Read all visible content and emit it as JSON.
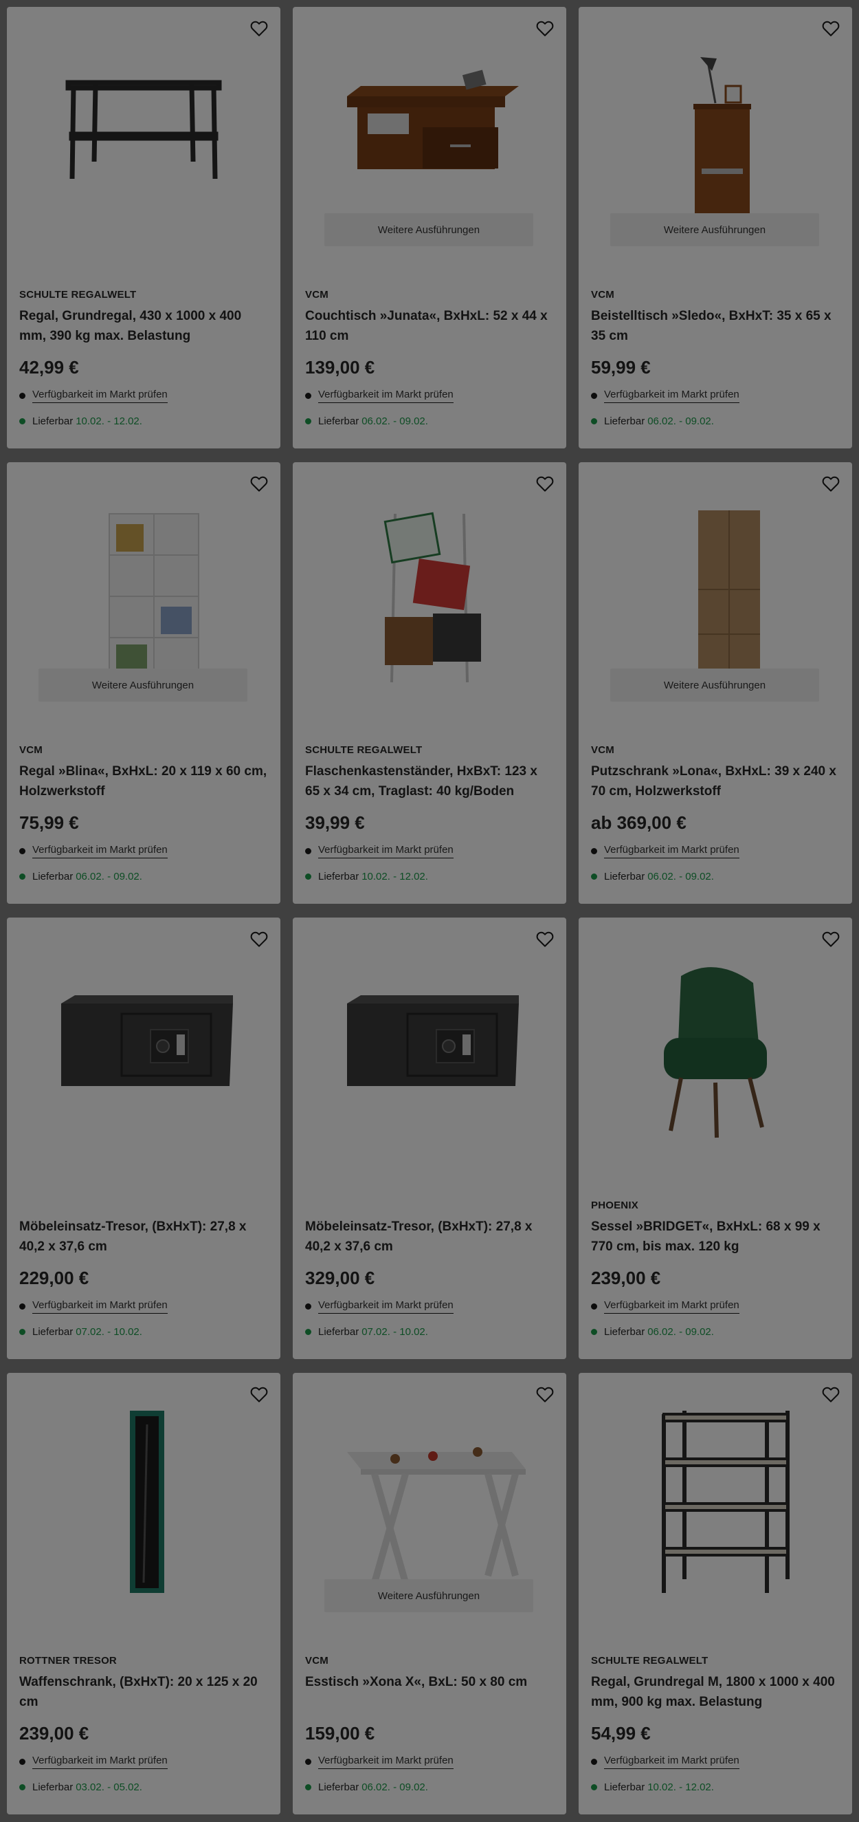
{
  "accent_color": "#1c9a4a",
  "overlay_color": "rgba(0,0,0,0.5)",
  "products": [
    {
      "image": "metal-shelf-wide",
      "brand": "SCHULTE REGALWELT",
      "title": "Regal, Grundregal, 430 x 1000 x 400 mm, 390 kg max. Belastung",
      "price": "42,99 €",
      "variants": "",
      "availability": "Verfügbarkeit im Markt prüfen",
      "delivery_label": "Lieferbar",
      "delivery_range": "10.02. - 12.02."
    },
    {
      "image": "coffee-table",
      "brand": "VCM",
      "title": "Couchtisch »Junata«, BxHxL: 52 x 44 x 110 cm",
      "price": "139,00 €",
      "variants": "Weitere Ausführungen",
      "availability": "Verfügbarkeit im Markt prüfen",
      "delivery_label": "Lieferbar",
      "delivery_range": "06.02. - 09.02."
    },
    {
      "image": "side-table",
      "brand": "VCM",
      "title": "Beistelltisch »Sledo«, BxHxT: 35 x 65 x 35 cm",
      "price": "59,99 €",
      "variants": "Weitere Ausführungen",
      "availability": "Verfügbarkeit im Markt prüfen",
      "delivery_label": "Lieferbar",
      "delivery_range": "06.02. - 09.02."
    },
    {
      "image": "bookshelf-white",
      "brand": "VCM",
      "title": "Regal »Blina«, BxHxL: 20 x 119 x 60 cm, Holzwerkstoff",
      "price": "75,99 €",
      "variants": "Weitere Ausführungen",
      "availability": "Verfügbarkeit im Markt prüfen",
      "delivery_label": "Lieferbar",
      "delivery_range": "06.02. - 09.02."
    },
    {
      "image": "crate-stand",
      "brand": "SCHULTE REGALWELT",
      "title": "Flaschenkastenständer, HxBxT: 123 x 65 x 34 cm, Traglast: 40 kg/Boden",
      "price": "39,99 €",
      "variants": "",
      "availability": "Verfügbarkeit im Markt prüfen",
      "delivery_label": "Lieferbar",
      "delivery_range": "10.02. - 12.02."
    },
    {
      "image": "tall-cabinet",
      "brand": "VCM",
      "title": "Putzschrank »Lona«, BxHxL: 39 x 240 x 70 cm, Holzwerkstoff",
      "price": "ab 369,00 €",
      "variants": "Weitere Ausführungen",
      "availability": "Verfügbarkeit im Markt prüfen",
      "delivery_label": "Lieferbar",
      "delivery_range": "06.02. - 09.02."
    },
    {
      "image": "safe",
      "brand": "",
      "title": "Möbeleinsatz-Tresor, (BxHxT): 27,8 x 40,2 x 37,6 cm",
      "price": "229,00 €",
      "variants": "",
      "availability": "Verfügbarkeit im Markt prüfen",
      "delivery_label": "Lieferbar",
      "delivery_range": "07.02. - 10.02."
    },
    {
      "image": "safe",
      "brand": "",
      "title": "Möbeleinsatz-Tresor, (BxHxT): 27,8 x 40,2 x 37,6 cm",
      "price": "329,00 €",
      "variants": "",
      "availability": "Verfügbarkeit im Markt prüfen",
      "delivery_label": "Lieferbar",
      "delivery_range": "07.02. - 10.02."
    },
    {
      "image": "armchair",
      "brand": "PHOENIX",
      "title": "Sessel »BRIDGET«, BxHxL: 68 x 99 x 770 cm, bis max. 120 kg",
      "price": "239,00 €",
      "variants": "",
      "availability": "Verfügbarkeit im Markt prüfen",
      "delivery_label": "Lieferbar",
      "delivery_range": "06.02. - 09.02."
    },
    {
      "image": "gun-cabinet",
      "brand": "ROTTNER TRESOR",
      "title": "Waffenschrank, (BxHxT): 20 x 125 x 20 cm",
      "price": "239,00 €",
      "variants": "",
      "availability": "Verfügbarkeit im Markt prüfen",
      "delivery_label": "Lieferbar",
      "delivery_range": "03.02. - 05.02."
    },
    {
      "image": "dining-table",
      "brand": "VCM",
      "title": "Esstisch »Xona X«, BxL: 50 x 80 cm",
      "price": "159,00 €",
      "variants": "Weitere Ausführungen",
      "availability": "Verfügbarkeit im Markt prüfen",
      "delivery_label": "Lieferbar",
      "delivery_range": "06.02. - 09.02."
    },
    {
      "image": "metal-shelf-tall",
      "brand": "SCHULTE REGALWELT",
      "title": "Regal, Grundregal M, 1800 x 1000 x 400 mm, 900 kg max. Belastung",
      "price": "54,99 €",
      "variants": "",
      "availability": "Verfügbarkeit im Markt prüfen",
      "delivery_label": "Lieferbar",
      "delivery_range": "10.02. - 12.02."
    }
  ]
}
